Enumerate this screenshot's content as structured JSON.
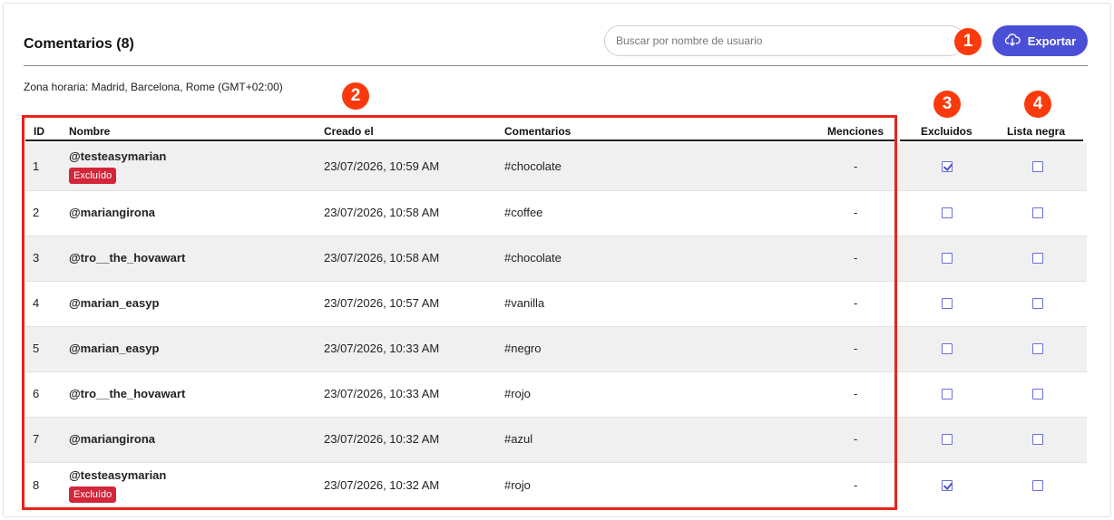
{
  "header": {
    "title": "Comentarios (8)",
    "search_placeholder": "Buscar por nombre de usuario",
    "export_label": "Exportar"
  },
  "timezone": "Zona horaria: Madrid, Barcelona, Rome (GMT+02:00)",
  "annotations": [
    "1",
    "2",
    "3",
    "4"
  ],
  "columns": {
    "id": "ID",
    "name": "Nombre",
    "created": "Creado el",
    "comments": "Comentarios",
    "mentions": "Menciones",
    "excluded": "Excluidos",
    "blacklist": "Lista negra"
  },
  "excluded_tag": "Excluído",
  "rows": [
    {
      "id": "1",
      "name": "@testeasymarian",
      "created": "23/07/2026, 10:59 AM",
      "comment": "#chocolate",
      "mentions": "-",
      "excluded": true,
      "blacklist": false
    },
    {
      "id": "2",
      "name": "@mariangirona",
      "created": "23/07/2026, 10:58 AM",
      "comment": "#coffee",
      "mentions": "-",
      "excluded": false,
      "blacklist": false
    },
    {
      "id": "3",
      "name": "@tro__the_hovawart",
      "created": "23/07/2026, 10:58 AM",
      "comment": "#chocolate",
      "mentions": "-",
      "excluded": false,
      "blacklist": false
    },
    {
      "id": "4",
      "name": "@marian_easyp",
      "created": "23/07/2026, 10:57 AM",
      "comment": "#vanilla",
      "mentions": "-",
      "excluded": false,
      "blacklist": false
    },
    {
      "id": "5",
      "name": "@marian_easyp",
      "created": "23/07/2026, 10:33 AM",
      "comment": "#negro",
      "mentions": "-",
      "excluded": false,
      "blacklist": false
    },
    {
      "id": "6",
      "name": "@tro__the_hovawart",
      "created": "23/07/2026, 10:33 AM",
      "comment": "#rojo",
      "mentions": "-",
      "excluded": false,
      "blacklist": false
    },
    {
      "id": "7",
      "name": "@mariangirona",
      "created": "23/07/2026, 10:32 AM",
      "comment": "#azul",
      "mentions": "-",
      "excluded": false,
      "blacklist": false
    },
    {
      "id": "8",
      "name": "@testeasymarian",
      "created": "23/07/2026, 10:32 AM",
      "comment": "#rojo",
      "mentions": "-",
      "excluded": true,
      "blacklist": false
    }
  ],
  "colors": {
    "accent": "#4a4fd6",
    "excluded_tag": "#d2263a",
    "annotation": "#fa3a0c",
    "highlight_box": "#e8241a"
  },
  "icons": {
    "export": "cloud-download-icon",
    "checkbox": "checkbox-icon"
  }
}
